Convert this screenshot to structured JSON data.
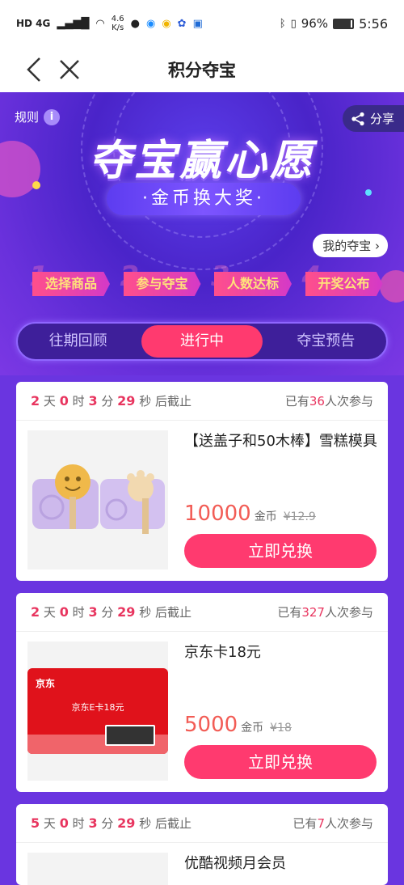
{
  "status": {
    "network_tags": "HD 4G",
    "speed_value": "4.6",
    "speed_unit": "K/s",
    "battery": "96%",
    "time": "5:56"
  },
  "nav": {
    "title": "积分夺宝",
    "back_icon": "chevron-left-icon",
    "close_icon": "close-icon"
  },
  "banner": {
    "rules_label": "规则",
    "share_label": "分享",
    "headline": "夺宝赢心愿",
    "subhead": "·金币换大奖·",
    "my_label": "我的夺宝",
    "steps": [
      {
        "num": "1",
        "label": "选择商品"
      },
      {
        "num": "2",
        "label": "参与夺宝"
      },
      {
        "num": "3",
        "label": "人数达标"
      },
      {
        "num": "4",
        "label": "开奖公布"
      }
    ]
  },
  "tabs": [
    {
      "label": "往期回顾",
      "active": false
    },
    {
      "label": "进行中",
      "active": true
    },
    {
      "label": "夺宝预告",
      "active": false
    }
  ],
  "countdown_units": {
    "day": "天",
    "hour": "时",
    "min": "分",
    "sec": "秒",
    "suffix": "后截止"
  },
  "participants_prefix": "已有",
  "participants_suffix": "人次参与",
  "buy_label": "立即兑换",
  "coin_unit": "金币",
  "items": [
    {
      "days": "2",
      "hours": "0",
      "mins": "3",
      "secs": "29",
      "participants": "36",
      "title": "【送盖子和50木棒】雪糕模具",
      "price": "10000",
      "old_price": "¥12.9"
    },
    {
      "days": "2",
      "hours": "0",
      "mins": "3",
      "secs": "29",
      "participants": "327",
      "title": "京东卡18元",
      "price": "5000",
      "old_price": "¥18",
      "card_brand": "京东",
      "card_text": "京东E卡18元"
    },
    {
      "days": "5",
      "hours": "0",
      "mins": "3",
      "secs": "29",
      "participants": "7",
      "title": "优酷视频月会员"
    }
  ]
}
